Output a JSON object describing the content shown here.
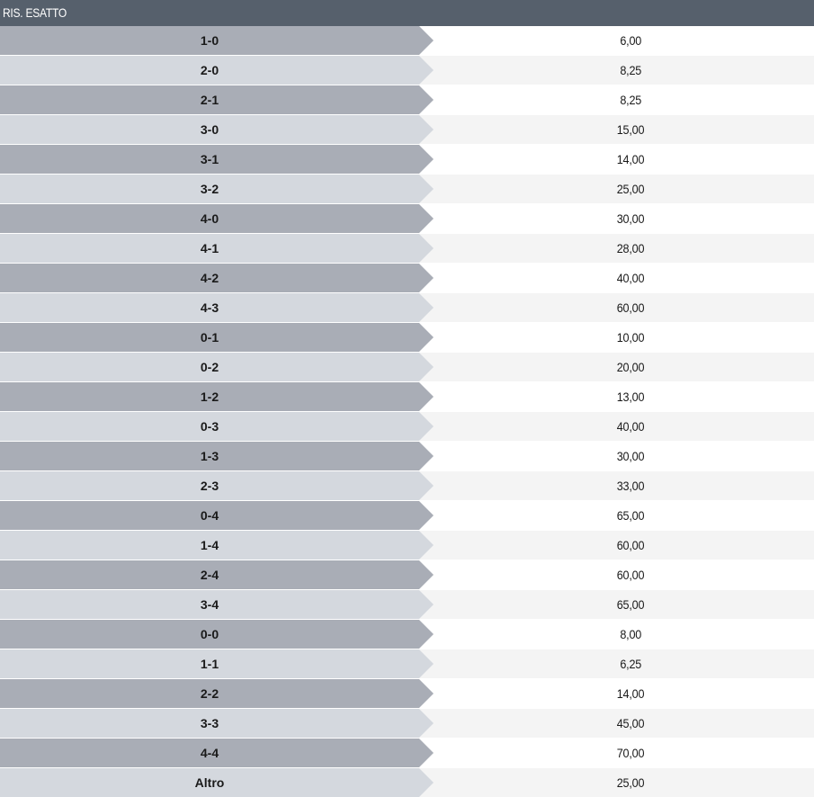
{
  "header": {
    "title": "RIS. ESATTO"
  },
  "rows": [
    {
      "score": "1-0",
      "odds": "6,00"
    },
    {
      "score": "2-0",
      "odds": "8,25"
    },
    {
      "score": "2-1",
      "odds": "8,25"
    },
    {
      "score": "3-0",
      "odds": "15,00"
    },
    {
      "score": "3-1",
      "odds": "14,00"
    },
    {
      "score": "3-2",
      "odds": "25,00"
    },
    {
      "score": "4-0",
      "odds": "30,00"
    },
    {
      "score": "4-1",
      "odds": "28,00"
    },
    {
      "score": "4-2",
      "odds": "40,00"
    },
    {
      "score": "4-3",
      "odds": "60,00"
    },
    {
      "score": "0-1",
      "odds": "10,00"
    },
    {
      "score": "0-2",
      "odds": "20,00"
    },
    {
      "score": "1-2",
      "odds": "13,00"
    },
    {
      "score": "0-3",
      "odds": "40,00"
    },
    {
      "score": "1-3",
      "odds": "30,00"
    },
    {
      "score": "2-3",
      "odds": "33,00"
    },
    {
      "score": "0-4",
      "odds": "65,00"
    },
    {
      "score": "1-4",
      "odds": "60,00"
    },
    {
      "score": "2-4",
      "odds": "60,00"
    },
    {
      "score": "3-4",
      "odds": "65,00"
    },
    {
      "score": "0-0",
      "odds": "8,00"
    },
    {
      "score": "1-1",
      "odds": "6,25"
    },
    {
      "score": "2-2",
      "odds": "14,00"
    },
    {
      "score": "3-3",
      "odds": "45,00"
    },
    {
      "score": "4-4",
      "odds": "70,00"
    },
    {
      "score": "Altro",
      "odds": "25,00"
    }
  ],
  "colors": {
    "header_bg": "#56606c",
    "score_dark": "#a9adb6",
    "score_light": "#d4d8de",
    "odds_white": "#ffffff",
    "odds_grey": "#f4f4f4"
  }
}
